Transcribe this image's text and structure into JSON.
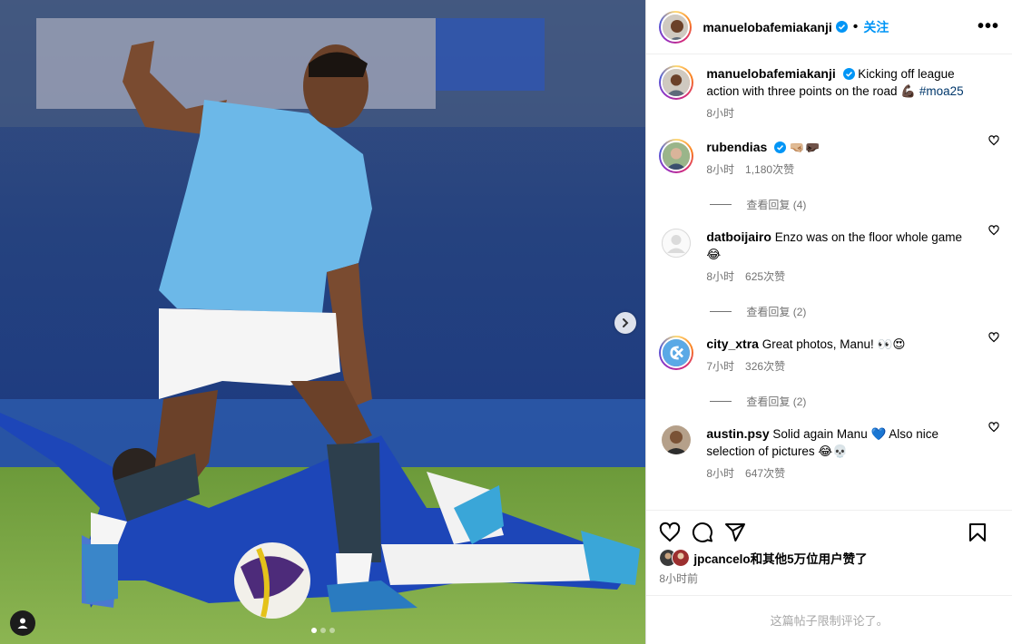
{
  "post": {
    "author": "manuelobafemiakanji",
    "follow_label": "关注",
    "more_label": "•••",
    "dot": "•",
    "caption": {
      "username": "manuelobafemiakanji",
      "text": "Kicking off league action with three points on the road 💪🏿",
      "hashtag": "#moa25",
      "time": "8小时"
    },
    "likes_text": "jpcancelo和其他5万位用户赞了",
    "time_ago": "8小时前",
    "comments_limited": "这篇帖子限制评论了。"
  },
  "comments": [
    {
      "username": "rubendias",
      "verified": true,
      "text": "🤜🏼🤛🏿",
      "time": "8小时",
      "likes": "1,180次赞",
      "replies": "查看回复 (4)"
    },
    {
      "username": "datboijairo",
      "verified": false,
      "text": "Enzo was on the floor whole game 😂",
      "time": "8小时",
      "likes": "625次赞",
      "replies": "查看回复 (2)"
    },
    {
      "username": "city_xtra",
      "verified": false,
      "text": "Great photos, Manu! 👀😍",
      "time": "7小时",
      "likes": "326次赞",
      "replies": "查看回复 (2)"
    },
    {
      "username": "austin.psy",
      "verified": false,
      "text": "Solid again Manu 💙 Also nice selection of pictures 😂💀",
      "time": "8小时",
      "likes": "647次赞",
      "replies": ""
    }
  ],
  "icons": {
    "like": "heart-icon",
    "comment": "comment-icon",
    "share": "share-icon",
    "save": "bookmark-icon",
    "next": "chevron-right-icon",
    "tags": "user-tag-icon"
  },
  "carousel": {
    "pages": 3,
    "current": 1
  }
}
